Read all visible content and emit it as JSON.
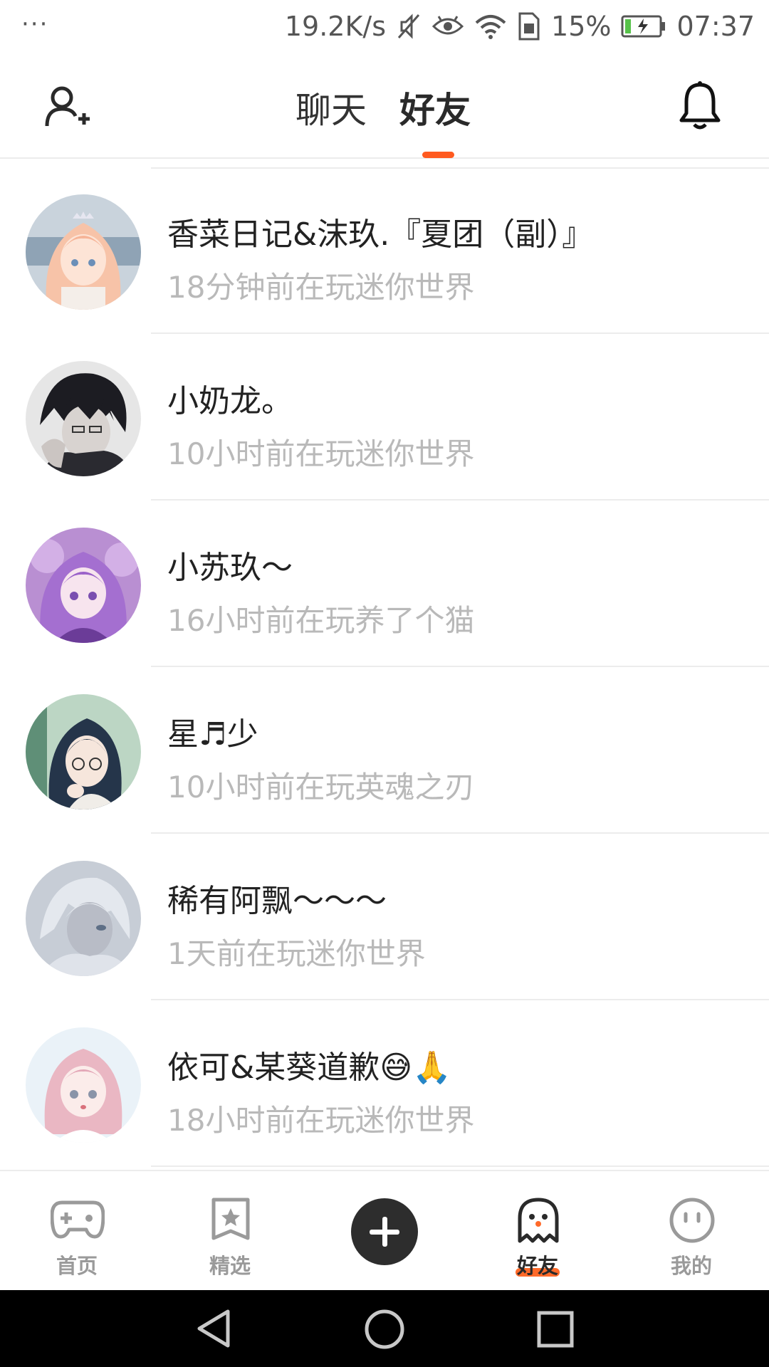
{
  "status_bar": {
    "dots": "···",
    "speed": "19.2K/s",
    "battery_percent": "15%",
    "time": "07:37"
  },
  "header": {
    "tabs": [
      {
        "label": "聊天",
        "active": false
      },
      {
        "label": "好友",
        "active": true
      }
    ],
    "accent_color": "#ff5a1f"
  },
  "friends": [
    {
      "name": "香菜日记&沫玖.『夏团（副）』",
      "status": "18分钟前在玩迷你世界",
      "avatar": "anime-girl-peach-hair-icon"
    },
    {
      "name": "小奶龙。",
      "status": "10小时前在玩迷你世界",
      "avatar": "anime-boy-dark-hair-icon"
    },
    {
      "name": "小苏玖～",
      "status": "16小时前在玩养了个猫",
      "avatar": "anime-girl-purple-hair-icon"
    },
    {
      "name": "星♬少",
      "status": "10小时前在玩英魂之刃",
      "avatar": "anime-girl-glasses-icon"
    },
    {
      "name": "稀有阿飘～～～",
      "status": "1天前在玩迷你世界",
      "avatar": "anime-boy-grey-icon"
    },
    {
      "name": "依可&某葵道歉😅🙏",
      "status": "18小时前在玩迷你世界",
      "avatar": "anime-girl-pink-hair-icon"
    }
  ],
  "bottom_nav": {
    "home": "首页",
    "picks": "精选",
    "friends": "好友",
    "me": "我的"
  }
}
